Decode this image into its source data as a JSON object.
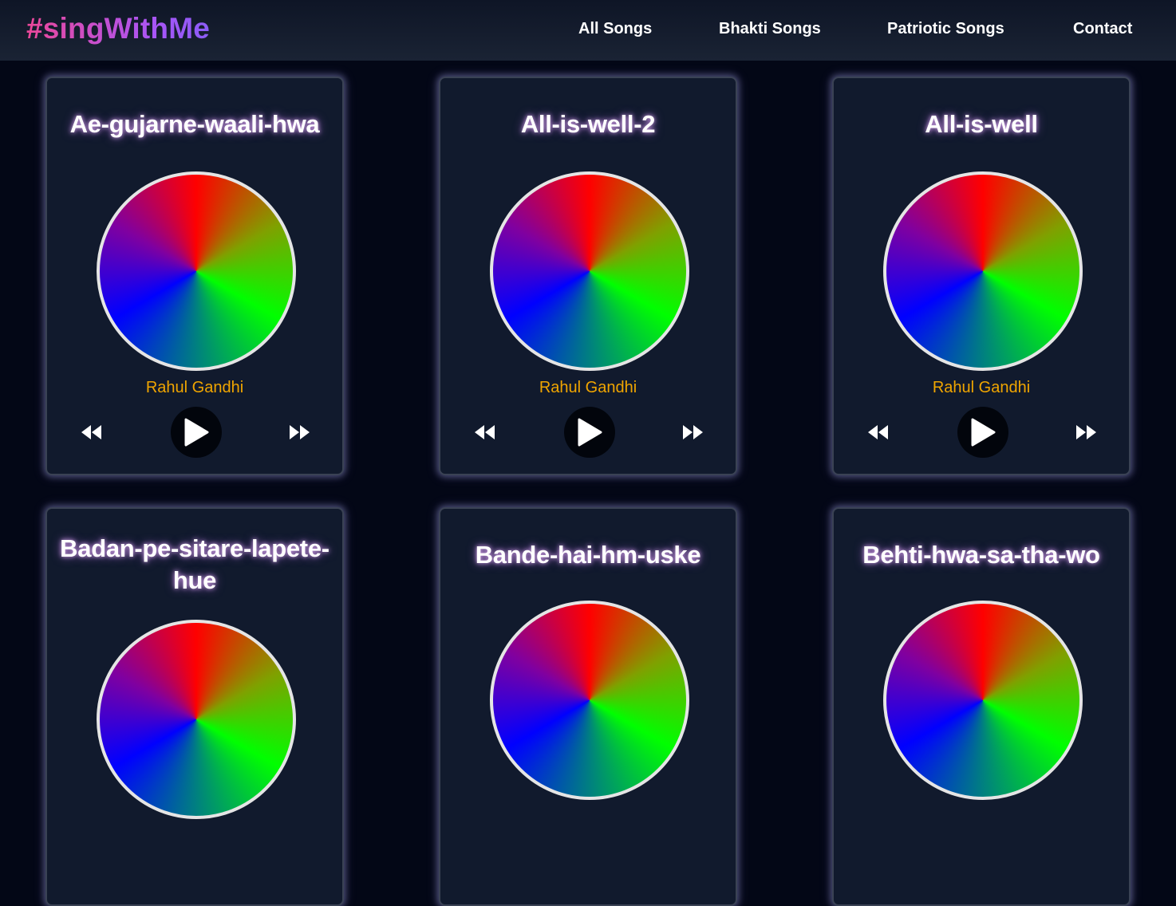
{
  "header": {
    "logo": "#singWithMe",
    "nav": [
      {
        "label": "All Songs"
      },
      {
        "label": "Bhakti Songs"
      },
      {
        "label": "Patriotic Songs"
      },
      {
        "label": "Contact"
      }
    ]
  },
  "songs": [
    {
      "title": "Ae-gujarne-waali-hwa",
      "artist": "Rahul Gandhi"
    },
    {
      "title": "All-is-well-2",
      "artist": "Rahul Gandhi"
    },
    {
      "title": "All-is-well",
      "artist": "Rahul Gandhi"
    },
    {
      "title": "Badan-pe-sitare-lapete-hue"
    },
    {
      "title": "Bande-hai-hm-uske"
    },
    {
      "title": "Behti-hwa-sa-tha-wo"
    }
  ],
  "icons": {
    "previous": "backward-icon",
    "play": "play-icon",
    "next": "forward-icon"
  },
  "colors": {
    "background": "#030716",
    "card": "#111a2d",
    "artist": "#f0a500",
    "logo_gradient": [
      "#ec4899",
      "#a855f7"
    ]
  }
}
